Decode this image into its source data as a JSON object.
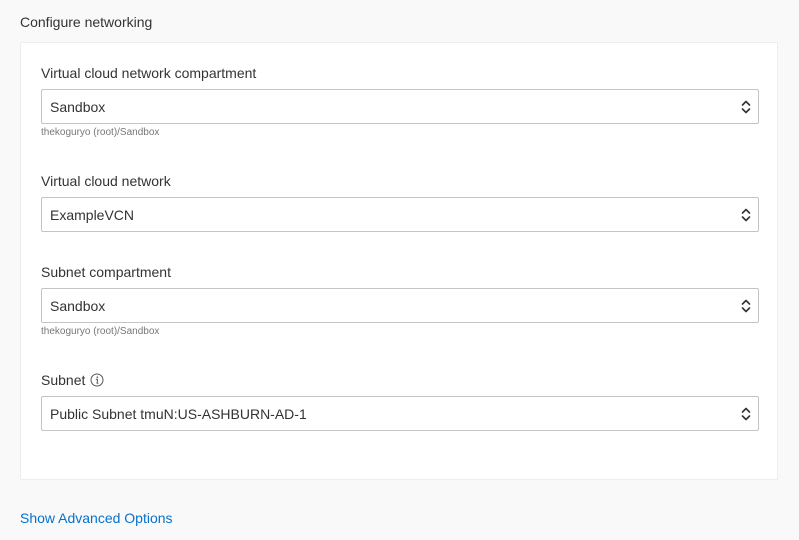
{
  "section": {
    "title": "Configure networking"
  },
  "fields": {
    "vcn_compartment": {
      "label": "Virtual cloud network compartment",
      "value": "Sandbox",
      "help": "thekoguryo (root)/Sandbox"
    },
    "vcn": {
      "label": "Virtual cloud network",
      "value": "ExampleVCN"
    },
    "subnet_compartment": {
      "label": "Subnet compartment",
      "value": "Sandbox",
      "help": "thekoguryo (root)/Sandbox"
    },
    "subnet": {
      "label": "Subnet",
      "value": "Public Subnet tmuN:US-ASHBURN-AD-1",
      "info_icon": "info-icon"
    }
  },
  "links": {
    "advanced": "Show Advanced Options"
  },
  "colors": {
    "link": "#0572ce",
    "text": "#333333",
    "help_text": "#777777",
    "border": "#c4c4c4",
    "background": "#f9f9f9",
    "card": "#ffffff"
  }
}
